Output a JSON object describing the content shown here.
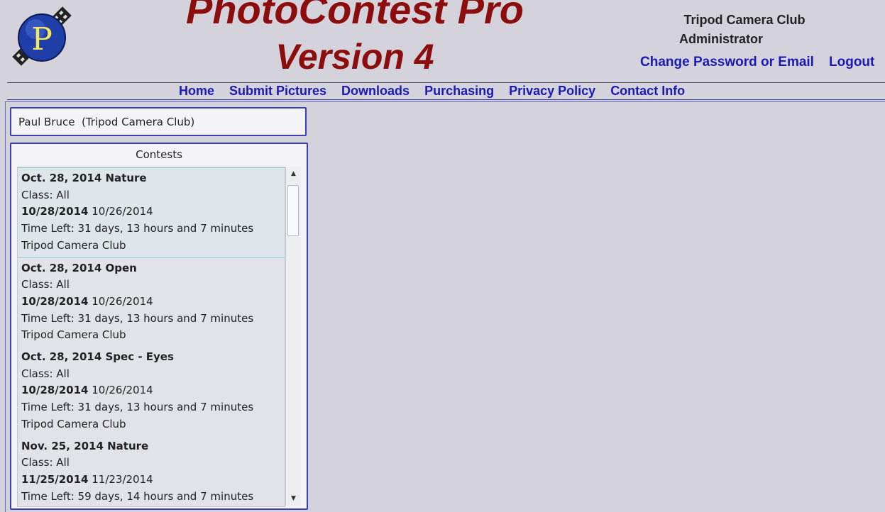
{
  "header": {
    "title_line1": "PhotoContest Pro",
    "title_line2": "Version 4",
    "club": "Tripod Camera Club",
    "role": "Administrator",
    "change_password_label": "Change Password or Email",
    "logout_label": "Logout"
  },
  "nav": {
    "items": [
      "Home",
      "Submit Pictures",
      "Downloads",
      "Purchasing",
      "Privacy Policy",
      "Contact Info"
    ]
  },
  "user": {
    "display": "Paul Bruce  (Tripod Camera Club)"
  },
  "contests": {
    "title": "Contests",
    "items": [
      {
        "name": "Oct. 28, 2014 Nature",
        "class": "Class: All",
        "date1": "10/28/2014",
        "date2": "10/26/2014",
        "time_left": "Time Left: 31 days, 13 hours and 7 minutes",
        "club": "Tripod Camera Club"
      },
      {
        "name": "Oct. 28, 2014 Open",
        "class": "Class: All",
        "date1": "10/28/2014",
        "date2": "10/26/2014",
        "time_left": "Time Left: 31 days, 13 hours and 7 minutes",
        "club": "Tripod Camera Club"
      },
      {
        "name": "Oct. 28, 2014 Spec - Eyes",
        "class": "Class: All",
        "date1": "10/28/2014",
        "date2": "10/26/2014",
        "time_left": "Time Left: 31 days, 13 hours and 7 minutes",
        "club": "Tripod Camera Club"
      },
      {
        "name": "Nov. 25, 2014 Nature",
        "class": "Class: All",
        "date1": "11/25/2014",
        "date2": "11/23/2014",
        "time_left": "Time Left: 59 days, 14 hours and 7 minutes",
        "club": ""
      }
    ]
  },
  "colors": {
    "title": "#8b0d0d",
    "link": "#1a1ab4",
    "border": "#3d3db4",
    "background": "#d4d3dc"
  },
  "icons": {
    "logo": "photocontest-p-logo-icon",
    "scroll_up": "scroll-up-arrow-icon",
    "scroll_down": "scroll-down-arrow-icon"
  }
}
